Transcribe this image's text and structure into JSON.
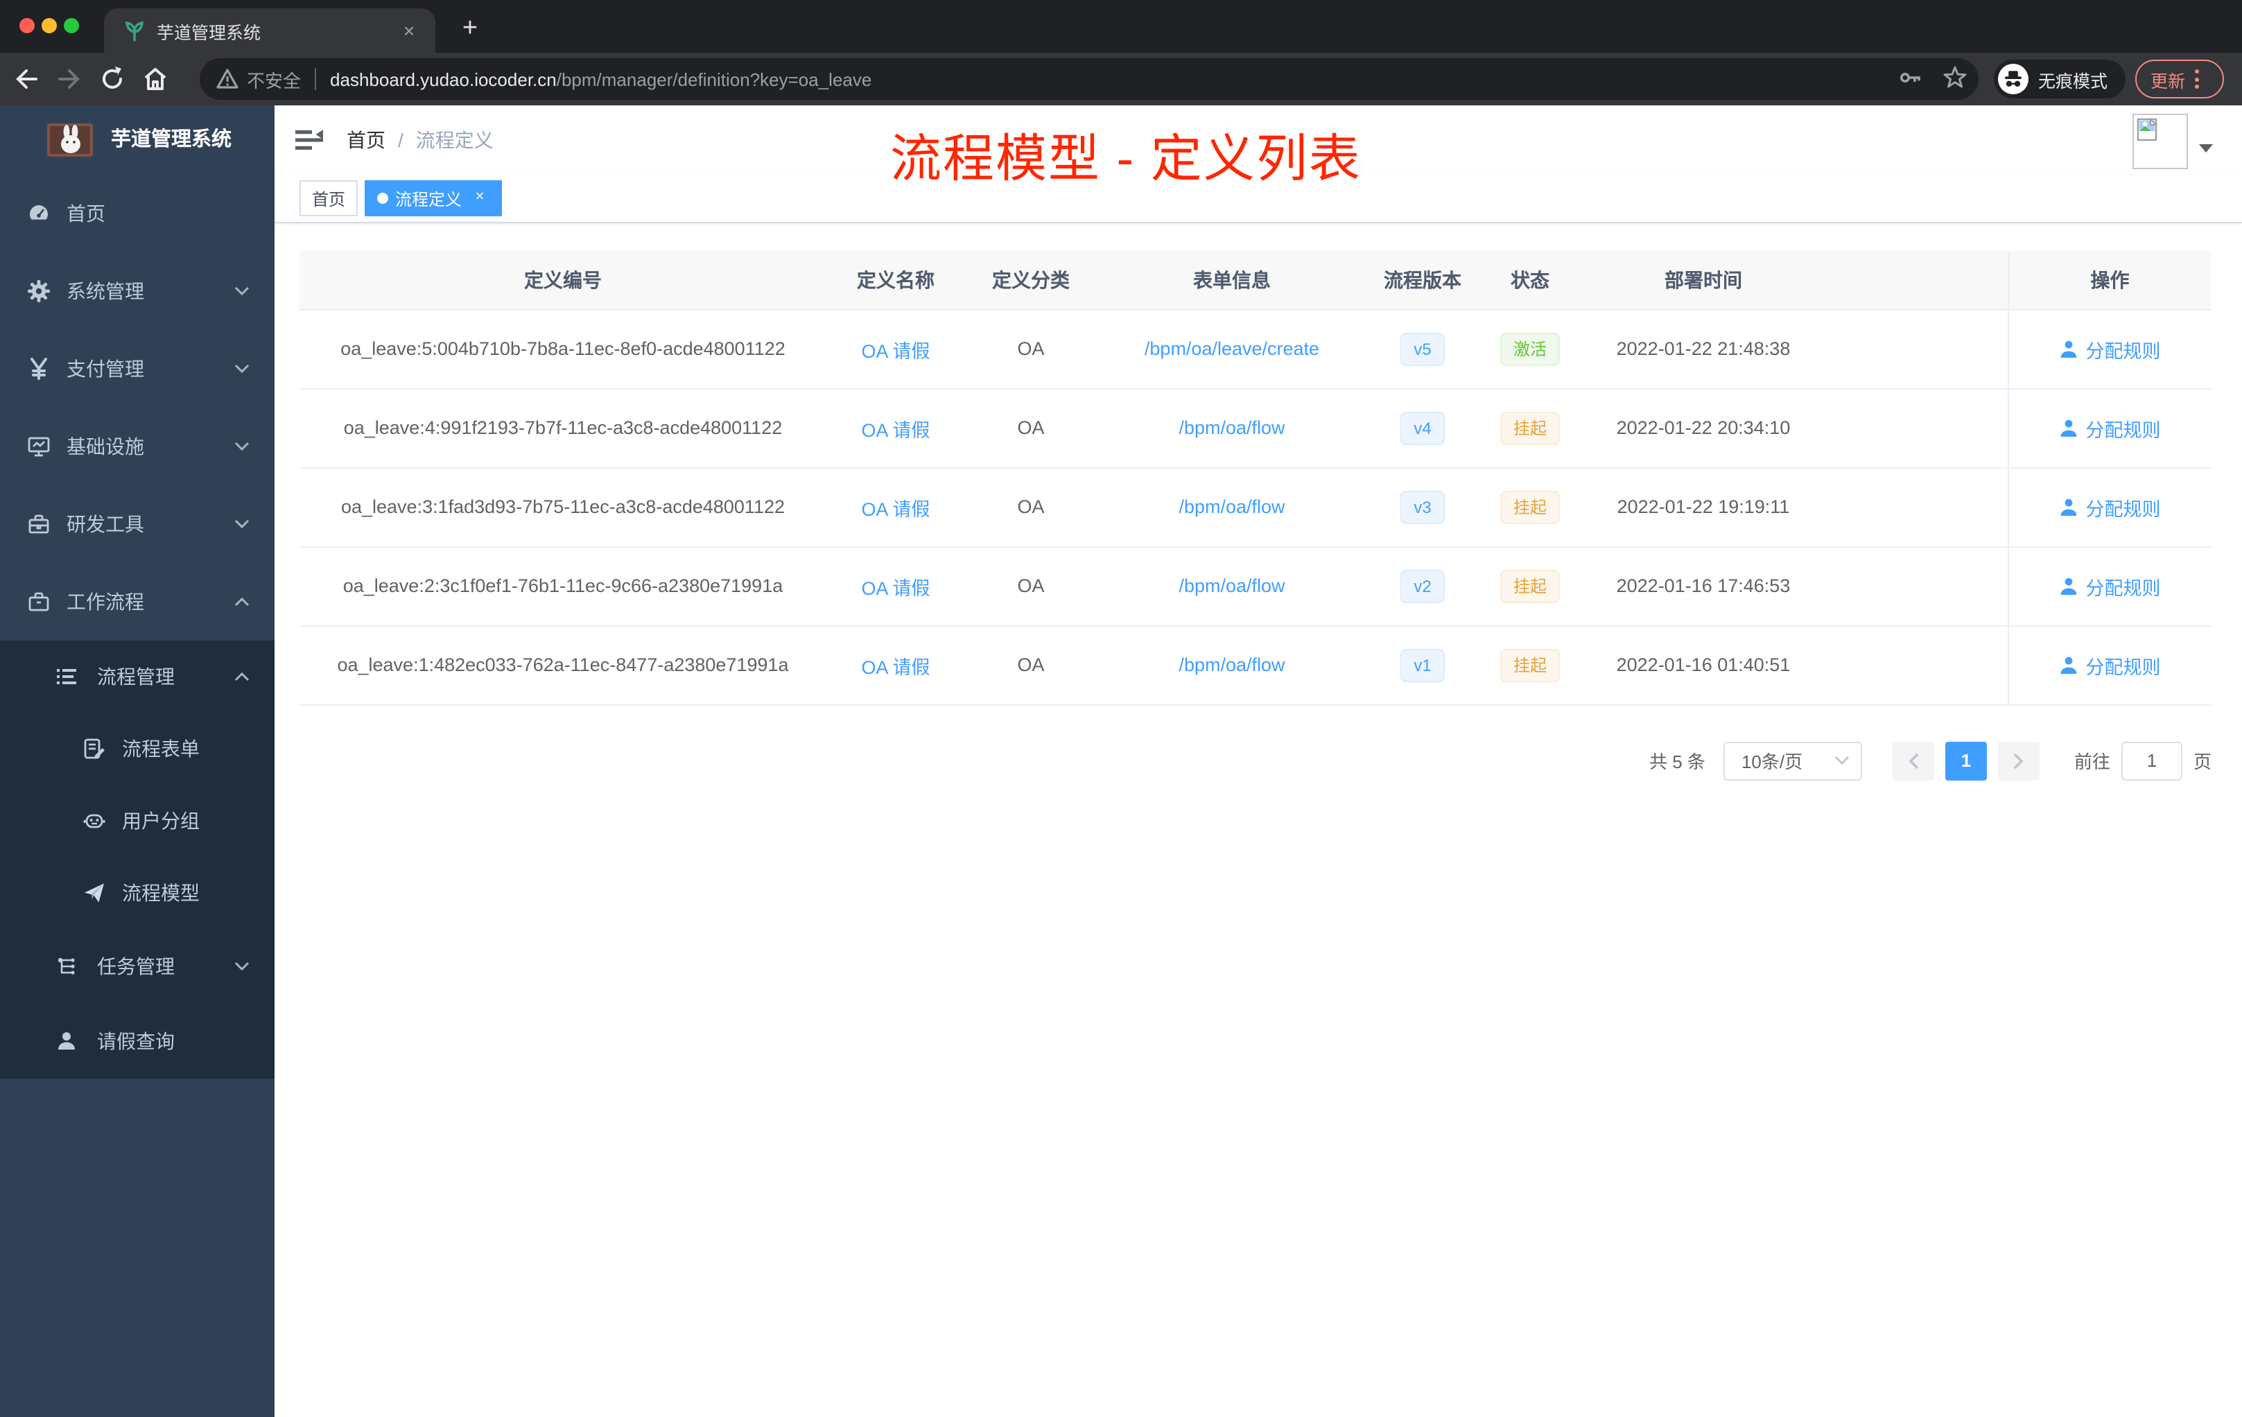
{
  "browser": {
    "tab": {
      "title": "芋道管理系统",
      "close_glyph": "×",
      "new_tab_glyph": "+"
    },
    "address": {
      "security_label": "不安全",
      "domain": "dashboard.yudao.iocoder.cn",
      "path": "/bpm/manager/definition?key=oa_leave"
    },
    "incognito_label": "无痕模式",
    "update_button": "更新"
  },
  "sidebar": {
    "logo_title": "芋道管理系统",
    "menu": [
      {
        "label": "首页",
        "icon": "dashboard-icon"
      },
      {
        "label": "系统管理",
        "icon": "gear-icon",
        "chevron": "down"
      },
      {
        "label": "支付管理",
        "icon": "yen-icon",
        "chevron": "down"
      },
      {
        "label": "基础设施",
        "icon": "monitor-icon",
        "chevron": "down"
      },
      {
        "label": "研发工具",
        "icon": "toolbox-icon",
        "chevron": "down"
      },
      {
        "label": "工作流程",
        "icon": "briefcase-icon",
        "chevron": "up"
      },
      {
        "label": "流程管理",
        "icon": "stream-icon",
        "chevron": "up"
      },
      {
        "label": "流程表单",
        "icon": "form-icon"
      },
      {
        "label": "用户分组",
        "icon": "robot-icon"
      },
      {
        "label": "流程模型",
        "icon": "plane-icon"
      },
      {
        "label": "任务管理",
        "icon": "tree-icon",
        "chevron": "down"
      },
      {
        "label": "请假查询",
        "icon": "user-icon"
      }
    ]
  },
  "navbar": {
    "breadcrumb": [
      "首页",
      "流程定义"
    ],
    "separator": "/"
  },
  "annotation": {
    "text": "流程模型 - 定义列表",
    "color": "#ff2600"
  },
  "tags_view": {
    "inactive_tag": "首页",
    "active_tag": "流程定义",
    "close_glyph": "×"
  },
  "table": {
    "columns": [
      "定义编号",
      "定义名称",
      "定义分类",
      "表单信息",
      "流程版本",
      "状态",
      "部署时间",
      "操作"
    ],
    "rows": [
      {
        "id": "oa_leave:5:004b710b-7b8a-11ec-8ef0-acde48001122",
        "name": "OA 请假",
        "category": "OA",
        "form": "/bpm/oa/leave/create",
        "version": "v5",
        "status": "激活",
        "status_type": "success",
        "time": "2022-01-22 21:48:38",
        "action": "分配规则"
      },
      {
        "id": "oa_leave:4:991f2193-7b7f-11ec-a3c8-acde48001122",
        "name": "OA 请假",
        "category": "OA",
        "form": "/bpm/oa/flow",
        "version": "v4",
        "status": "挂起",
        "status_type": "warning",
        "time": "2022-01-22 20:34:10",
        "action": "分配规则"
      },
      {
        "id": "oa_leave:3:1fad3d93-7b75-11ec-a3c8-acde48001122",
        "name": "OA 请假",
        "category": "OA",
        "form": "/bpm/oa/flow",
        "version": "v3",
        "status": "挂起",
        "status_type": "warning",
        "time": "2022-01-22 19:19:11",
        "action": "分配规则"
      },
      {
        "id": "oa_leave:2:3c1f0ef1-76b1-11ec-9c66-a2380e71991a",
        "name": "OA 请假",
        "category": "OA",
        "form": "/bpm/oa/flow",
        "version": "v2",
        "status": "挂起",
        "status_type": "warning",
        "time": "2022-01-16 17:46:53",
        "action": "分配规则"
      },
      {
        "id": "oa_leave:1:482ec033-762a-11ec-8477-a2380e71991a",
        "name": "OA 请假",
        "category": "OA",
        "form": "/bpm/oa/flow",
        "version": "v1",
        "status": "挂起",
        "status_type": "warning",
        "time": "2022-01-16 01:40:51",
        "action": "分配规则"
      }
    ]
  },
  "pagination": {
    "total_label": "共 5 条",
    "page_size_label": "10条/页",
    "current_page": "1",
    "goto_label": "前往",
    "goto_value": "1",
    "unit_label": "页"
  },
  "icons": {
    "question_glyph": "?",
    "text_size_glyph": "тT"
  },
  "colors": {
    "primary": "#409eff",
    "success": "#67c23a",
    "warning": "#e6a23c",
    "annotation_red": "#ff2600",
    "sidebar_bg": "#304156",
    "submenu_bg": "#1f2d3d",
    "chrome_dark": "#202124",
    "chrome_toolbar": "#35363a"
  }
}
